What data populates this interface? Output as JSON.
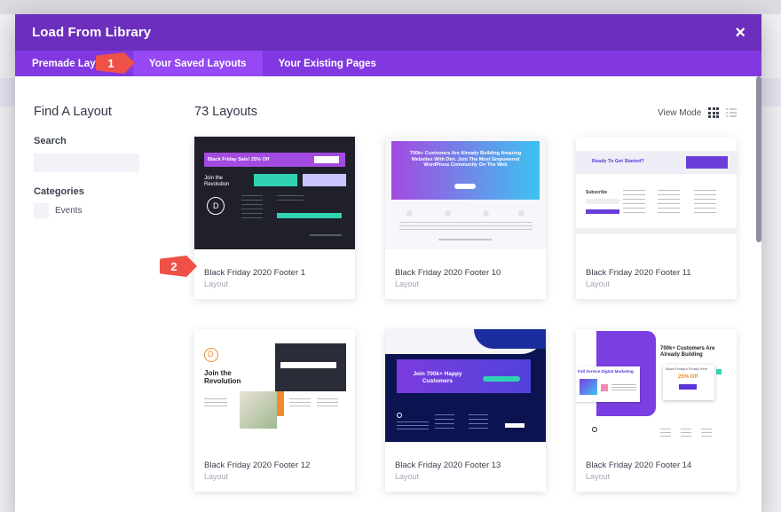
{
  "modal": {
    "title": "Load From Library",
    "close_icon": "×"
  },
  "tabs": [
    {
      "label": "Premade Layouts",
      "active": false
    },
    {
      "label": "Your Saved Layouts",
      "active": true
    },
    {
      "label": "Your Existing Pages",
      "active": false
    }
  ],
  "sidebar": {
    "title": "Find A Layout",
    "search_label": "Search",
    "search_value": "",
    "categories_label": "Categories",
    "categories": [
      {
        "label": "Events"
      }
    ]
  },
  "main": {
    "count_label": "73 Layouts",
    "view_mode_label": "View Mode"
  },
  "markers": {
    "one": "1",
    "two": "2"
  },
  "layouts": [
    {
      "name": "Black Friday 2020 Footer 1",
      "type": "Layout"
    },
    {
      "name": "Black Friday 2020 Footer 10",
      "type": "Layout"
    },
    {
      "name": "Black Friday 2020 Footer 11",
      "type": "Layout"
    },
    {
      "name": "Black Friday 2020 Footer 12",
      "type": "Layout"
    },
    {
      "name": "Black Friday 2020 Footer 13",
      "type": "Layout"
    },
    {
      "name": "Black Friday 2020 Footer 14",
      "type": "Layout"
    }
  ],
  "thumbs": {
    "t1": {
      "banner": "Black Friday Sale! 25% Off",
      "join": "Join the Revolution"
    },
    "t2": {
      "headline": "700k+ Customers Are Already Building Amazing Websites With Divi. Join The Most Empowered WordPress Community On The Web"
    },
    "t3": {
      "headline": "Ready To Get Started?",
      "subscribe": "Subscribe"
    },
    "t4": {
      "headline": "Join the Revolution"
    },
    "t5": {
      "headline": "Join 700k+ Happy Customers"
    },
    "t6": {
      "headline": "700k+ Customers Are Already Building",
      "service": "Full Service Digital Marketing",
      "offer": "25% Off",
      "sub": "Black Friday's Finally Here"
    }
  },
  "colors": {
    "header": "#6c2ebd",
    "tabs": "#8138e0",
    "active_tab": "#9548f3",
    "marker": "#ef5148"
  }
}
